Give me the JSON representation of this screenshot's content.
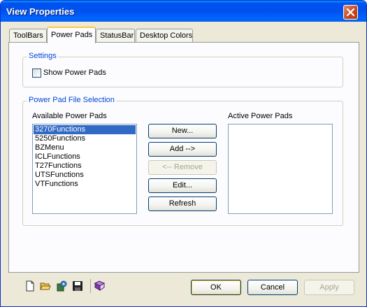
{
  "window": {
    "title": "View Properties"
  },
  "tabs": [
    {
      "label": "ToolBars",
      "active": false
    },
    {
      "label": "Power Pads",
      "active": true
    },
    {
      "label": "StatusBar",
      "active": false
    },
    {
      "label": "Desktop Colors",
      "active": false
    }
  ],
  "settings": {
    "legend": "Settings",
    "show_power_pads": {
      "label": "Show Power Pads",
      "checked": false
    }
  },
  "selection": {
    "legend": "Power Pad File Selection",
    "available_label": "Available Power Pads",
    "active_label": "Active Power Pads",
    "available_items": [
      "3270Functions",
      "5250Functions",
      "BZMenu",
      "ICLFunctions",
      "T27Functions",
      "UTSFunctions",
      "VTFunctions"
    ],
    "selected_index": 0,
    "active_items": [],
    "buttons": {
      "new": "New...",
      "add": "Add  -->",
      "remove": "<-- Remove",
      "edit": "Edit...",
      "refresh": "Refresh"
    }
  },
  "footer": {
    "ok": "OK",
    "cancel": "Cancel",
    "apply": "Apply",
    "toolbar_icons": [
      "new-file-icon",
      "open-folder-icon",
      "settings-icon",
      "save-icon",
      "book-icon"
    ]
  },
  "colors": {
    "title_blue": "#0053ee",
    "accent_tab": "#ffc83c",
    "legend_blue": "#0046d5",
    "selection": "#316ac5"
  }
}
